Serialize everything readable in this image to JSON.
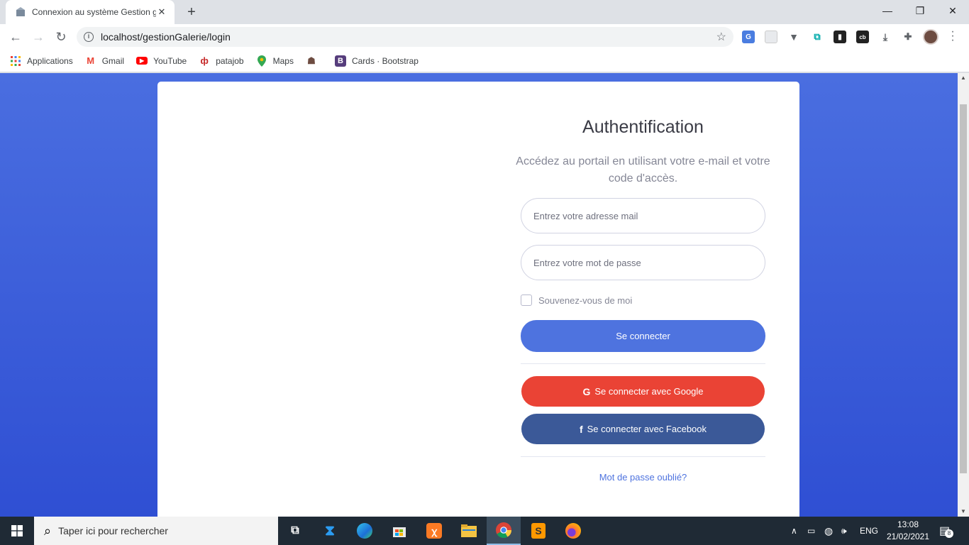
{
  "browser": {
    "tab_title": "Connexion au système Gestion g",
    "new_tab": "+",
    "url": "localhost/gestionGalerie/login",
    "bookmarks": [
      {
        "label": "Applications",
        "icon": "apps-grid-icon"
      },
      {
        "label": "Gmail",
        "icon": "gmail-icon"
      },
      {
        "label": "YouTube",
        "icon": "youtube-icon"
      },
      {
        "label": "patajob",
        "icon": "patajob-icon"
      },
      {
        "label": "Maps",
        "icon": "maps-icon"
      },
      {
        "label": "",
        "icon": "people-icon"
      },
      {
        "label": "Cards · Bootstrap",
        "icon": "bootstrap-icon"
      }
    ]
  },
  "login": {
    "title": "Authentification",
    "subtitle": "Accédez au portail en utilisant votre e-mail et votre code d'accès.",
    "email_placeholder": "Entrez votre adresse mail",
    "password_placeholder": "Entrez votre mot de passe",
    "remember_label": "Souvenez-vous de moi",
    "submit_label": "Se connecter",
    "google_label": "Se connecter avec Google",
    "facebook_label": "Se connecter avec Facebook",
    "forgot_label": "Mot de passe oublié?"
  },
  "taskbar": {
    "search_placeholder": "Taper ici pour rechercher",
    "language": "ENG",
    "time": "13:08",
    "date": "21/02/2021",
    "notifications": "8"
  },
  "colors": {
    "primary": "#4e73df",
    "google": "#ea4335",
    "facebook": "#3b5998",
    "background_gradient_top": "#4a6ee0",
    "background_gradient_bottom": "#2f4fd3"
  }
}
